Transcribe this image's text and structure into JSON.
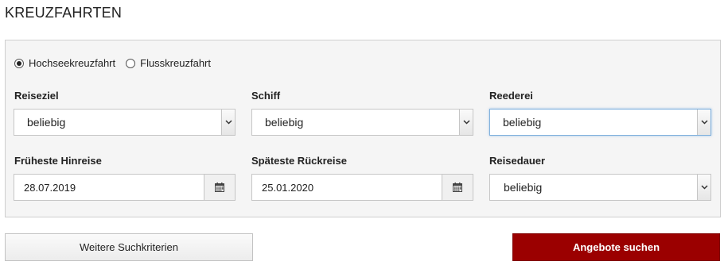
{
  "page": {
    "title": "KREUZFAHRTEN"
  },
  "cruise_type": {
    "options": [
      {
        "label": "Hochseekreuzfahrt",
        "selected": true
      },
      {
        "label": "Flusskreuzfahrt",
        "selected": false
      }
    ]
  },
  "fields": {
    "reiseziel": {
      "label": "Reiseziel",
      "value": "beliebig"
    },
    "schiff": {
      "label": "Schiff",
      "value": "beliebig"
    },
    "reederei": {
      "label": "Reederei",
      "value": "beliebig"
    },
    "hinreise": {
      "label": "Früheste Hinreise",
      "value": "28.07.2019"
    },
    "rueckreise": {
      "label": "Späteste Rückreise",
      "value": "25.01.2020"
    },
    "reisedauer": {
      "label": "Reisedauer",
      "value": "beliebig"
    }
  },
  "buttons": {
    "more_criteria": "Weitere Suchkriterien",
    "search": "Angebote suchen"
  },
  "colors": {
    "accent": "#9b0000",
    "panel_bg": "#f5f5f5",
    "focus_border": "#7fb0dd"
  },
  "icons": {
    "select": "chevron-down-icon",
    "date": "calendar-icon"
  }
}
